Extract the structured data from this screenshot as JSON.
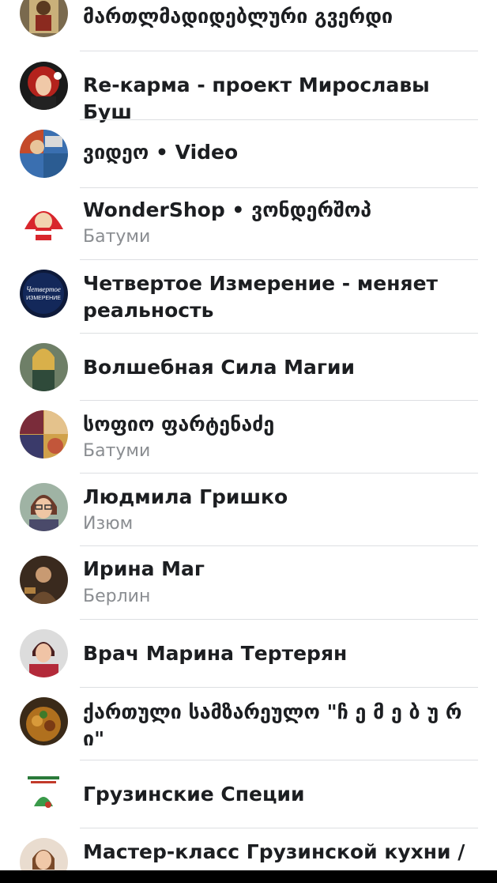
{
  "pages": [
    {
      "title": "მართლმადიდებლური გვერდი",
      "subtitle": "",
      "avatar_icon": "icon-painting-avatar"
    },
    {
      "title": "Re-карма - проект Мирославы Буш",
      "subtitle": "",
      "avatar_icon": "red-haired-woman-avatar"
    },
    {
      "title": "ვიდეო • Video",
      "subtitle": "",
      "avatar_icon": "video-collage-avatar"
    },
    {
      "title": "WonderShop • ვონდერშოპ",
      "subtitle": "Батуми",
      "avatar_icon": "wondershop-logo-avatar"
    },
    {
      "title": "Четвертое Измерение - меняет реальность",
      "subtitle": "",
      "avatar_icon": "fourth-dimension-logo-avatar"
    },
    {
      "title": "Волшебная Сила Магии",
      "subtitle": "",
      "avatar_icon": "magic-woman-avatar"
    },
    {
      "title": "სოფიო ფარტენაძე",
      "subtitle": "Батуми",
      "avatar_icon": "collage-avatar"
    },
    {
      "title": "Людмила Гришко",
      "subtitle": "Изюм",
      "avatar_icon": "woman-glasses-avatar"
    },
    {
      "title": "Ирина Маг",
      "subtitle": "Берлин",
      "avatar_icon": "dark-portrait-avatar"
    },
    {
      "title": "Врач Марина Тертерян",
      "subtitle": "",
      "avatar_icon": "doctor-woman-avatar"
    },
    {
      "title": "ქართული სამზარეულო \"ჩ ე მ ე ბ უ რ ი\"",
      "subtitle": "",
      "avatar_icon": "food-plate-avatar"
    },
    {
      "title": "Грузинские Специи",
      "subtitle": "",
      "avatar_icon": "spices-logo-avatar"
    },
    {
      "title": "Мастер-класс Грузинской кухни /",
      "subtitle": "",
      "avatar_icon": "woman-chef-avatar"
    }
  ]
}
